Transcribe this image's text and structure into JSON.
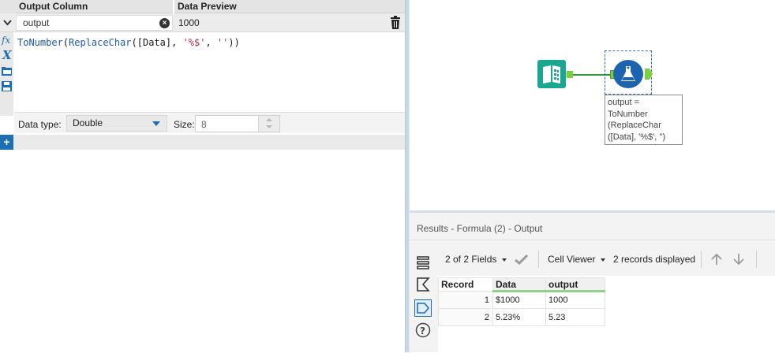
{
  "config": {
    "headers": {
      "output_column": "Output Column",
      "data_preview": "Data Preview"
    },
    "row": {
      "output_name": "output",
      "preview_value": "1000"
    },
    "expression": {
      "fn1": "ToNumber",
      "p1": "(",
      "fn2": "ReplaceChar",
      "p2": "([Data], ",
      "s1": "'%$'",
      "p3": ", ",
      "s2": "''",
      "p4": "))"
    },
    "data_type": {
      "label": "Data type:",
      "value": "Double"
    },
    "size": {
      "label": "Size:",
      "value": "8"
    },
    "tools": [
      "function-icon",
      "variable-icon",
      "open-folder-icon",
      "save-icon"
    ]
  },
  "canvas": {
    "annotation_lines": [
      "output =",
      "ToNumber",
      "(ReplaceChar",
      "([Data], '%$', '')"
    ]
  },
  "results": {
    "title": "Results - Formula (2) - Output",
    "fields_selector": "2 of 2 Fields",
    "viewer": "Cell Viewer",
    "records_displayed": "2 records displayed",
    "columns": [
      "Record",
      "Data",
      "output"
    ],
    "rows": [
      [
        "1",
        "$1000",
        "1000"
      ],
      [
        "2",
        "5.23%",
        "5.23"
      ]
    ]
  }
}
